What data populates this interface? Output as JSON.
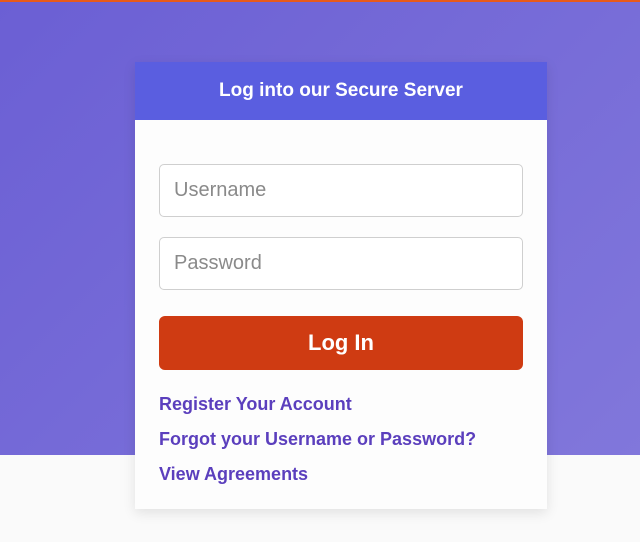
{
  "card": {
    "header": "Log into our Secure Server",
    "username_placeholder": "Username",
    "password_placeholder": "Password",
    "login_button": "Log In",
    "links": {
      "register": "Register Your Account",
      "forgot": "Forgot your Username or Password?",
      "agreements": "View Agreements"
    }
  }
}
